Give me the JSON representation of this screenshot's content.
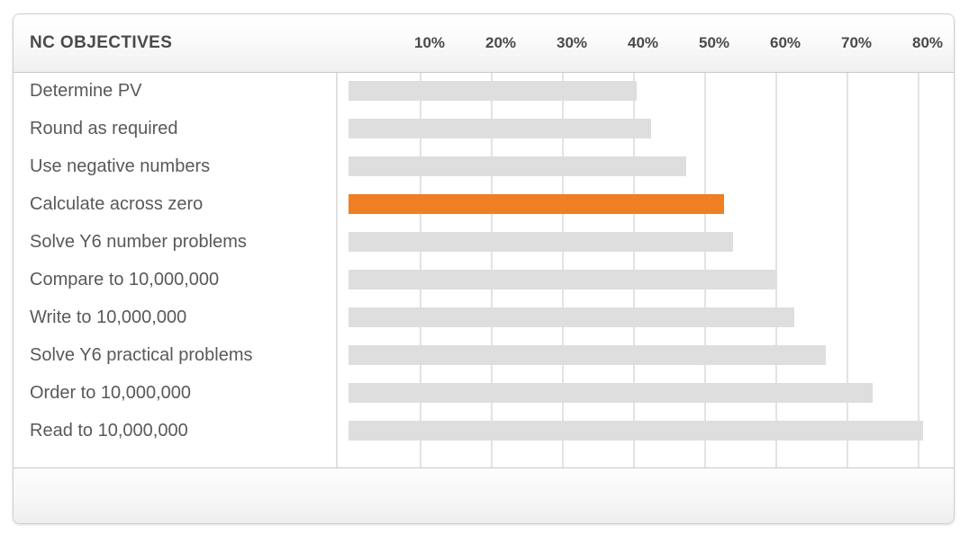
{
  "header": {
    "title": "NC OBJECTIVES"
  },
  "axis": {
    "ticks": [
      "10%",
      "20%",
      "30%",
      "40%",
      "50%",
      "60%",
      "70%",
      "80%"
    ]
  },
  "colors": {
    "bar": "#dedede",
    "highlight": "#ef7f22",
    "gridline": "#e3e3e3",
    "text": "#595959",
    "header_text": "#4a4a4a"
  },
  "footer": {
    "text": ""
  },
  "chart_data": {
    "type": "bar",
    "orientation": "horizontal",
    "title": "NC OBJECTIVES",
    "xlabel": "",
    "ylabel": "",
    "xlim": [
      0,
      85
    ],
    "xticks": [
      10,
      20,
      30,
      40,
      50,
      60,
      70,
      80
    ],
    "xtick_labels": [
      "10%",
      "20%",
      "30%",
      "40%",
      "50%",
      "60%",
      "70%",
      "80%"
    ],
    "grid": true,
    "legend": false,
    "unit": "%",
    "highlight_index": 3,
    "categories": [
      "Determine PV",
      "Round as required",
      "Use negative numbers",
      "Calculate across zero",
      "Solve Y6 number problems",
      "Compare to 10,000,000",
      "Write to 10,000,000",
      "Solve Y6 practical problems",
      "Order to 10,000,000",
      "Read to 10,000,000"
    ],
    "values": [
      40.5,
      42.5,
      47.5,
      52.8,
      54.1,
      60.3,
      62.6,
      67.1,
      73.7,
      80.8
    ],
    "bar_colors": [
      "#dedede",
      "#dedede",
      "#dedede",
      "#ef7f22",
      "#dedede",
      "#dedede",
      "#dedede",
      "#dedede",
      "#dedede",
      "#dedede"
    ]
  }
}
